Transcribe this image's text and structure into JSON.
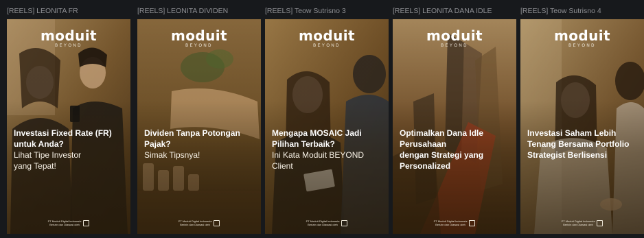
{
  "brand": {
    "wordmark": "moduit",
    "tagline": "BEYOND"
  },
  "reels": [
    {
      "label": "[REELS] LEONITA FR",
      "caption_bold": "Investasi Fixed Rate (FR)\nuntuk Anda?",
      "caption_light": "Lihat Tipe Investor\nyang Tepat!",
      "footer": "PT Moduit Digital Indonesia\nBerizin dan Diawasi oleh"
    },
    {
      "label": "[REELS] LEONITA DIVIDEN",
      "caption_bold": "Dividen Tanpa Potongan\nPajak?",
      "caption_light": "Simak Tipsnya!",
      "footer": "PT Moduit Digital Indonesia\nBerizin dan Diawasi oleh"
    },
    {
      "label": "[REELS] Teow Sutrisno 3",
      "caption_bold": "Mengapa MOSAIC Jadi\nPilihan Terbaik?",
      "caption_light": "Ini Kata Moduit BEYOND\nClient",
      "footer": "PT Moduit Digital Indonesia\nBerizin dan Diawasi oleh"
    },
    {
      "label": "[REELS] LEONITA DANA IDLE",
      "caption_bold": "Optimalkan Dana Idle\nPerusahaan\ndengan Strategi yang\nPersonalized",
      "caption_light": "",
      "footer": "PT Moduit Digital Indonesia\nBerizin dan Diawasi oleh"
    },
    {
      "label": "[REELS] Teow Sutrisno 4",
      "caption_bold": "Investasi Saham Lebih\nTenang Bersama Portfolio\nStrategist Berlisensi",
      "caption_light": "",
      "footer": "PT Moduit Digital Indonesia\nBerizin dan Diawasi oleh"
    }
  ],
  "colors": {
    "page_background": "#17191c",
    "label_text": "#8e8f93",
    "card_warm_tone": "#6e5128",
    "caption_text": "#ffffff"
  }
}
